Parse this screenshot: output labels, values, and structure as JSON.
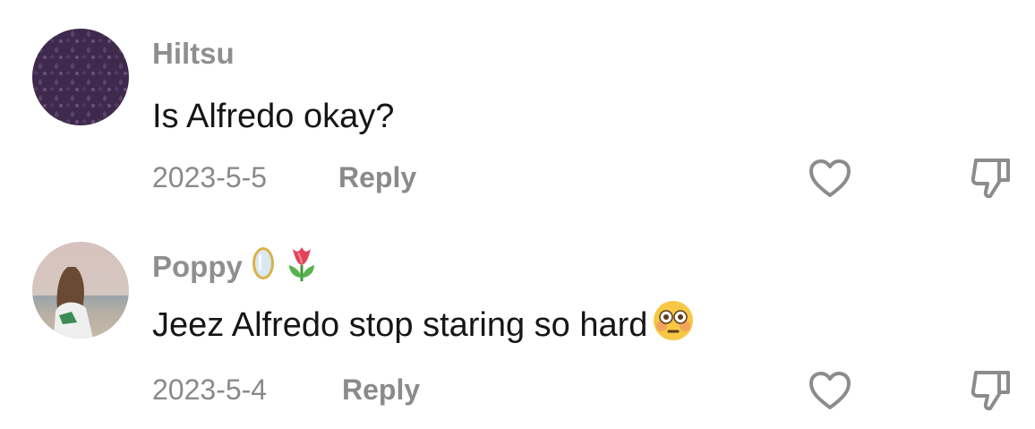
{
  "comments": [
    {
      "username": "Hiltsu",
      "username_emojis": [],
      "text": "Is Alfredo okay?",
      "text_emoji": "",
      "date": "2023-5-5",
      "reply_label": "Reply",
      "like_icon": "heart-outline-icon",
      "dislike_icon": "thumbs-down-outline-icon",
      "avatar": "purple-patterned-avatar"
    },
    {
      "username": "Poppy",
      "username_emojis": [
        "mirror-emoji",
        "tulip-emoji"
      ],
      "text": "Jeez Alfredo stop staring so hard",
      "text_emoji": "flushed-face-emoji",
      "date": "2023-5-4",
      "reply_label": "Reply",
      "like_icon": "heart-outline-icon",
      "dislike_icon": "thumbs-down-outline-icon",
      "avatar": "beach-photo-avatar"
    }
  ],
  "colors": {
    "username": "#8f8f8f",
    "text": "#161616",
    "meta": "#8a8a8a",
    "icon_stroke": "#8c8c8c"
  }
}
